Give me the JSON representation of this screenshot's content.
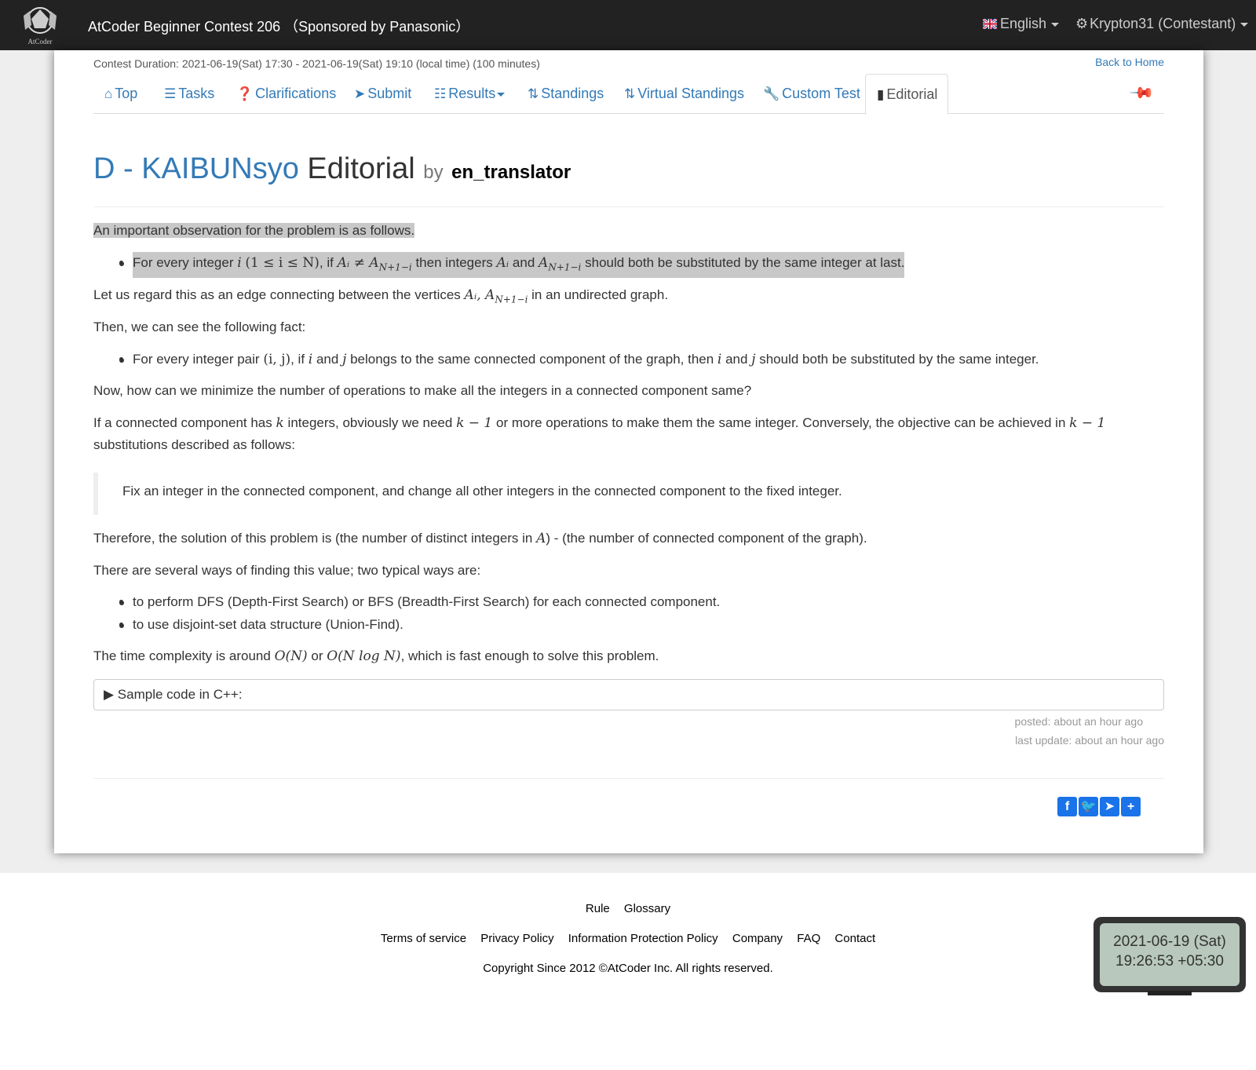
{
  "header": {
    "contest_title": "AtCoder Beginner Contest 206 （Sponsored by Panasonic）",
    "language": "English",
    "user": "Krypton31 (Contestant)"
  },
  "contest": {
    "duration": "Contest Duration: 2021-06-19(Sat) 17:30 - 2021-06-19(Sat) 19:10 (local time) (100 minutes)",
    "back_home": "Back to Home"
  },
  "tabs": [
    {
      "label": "Top",
      "icon": "home-icon"
    },
    {
      "label": "Tasks",
      "icon": "tasks-icon"
    },
    {
      "label": "Clarifications",
      "icon": "question-icon"
    },
    {
      "label": "Submit",
      "icon": "send-icon"
    },
    {
      "label": "Results",
      "icon": "list-icon"
    },
    {
      "label": "Standings",
      "icon": "sort-icon"
    },
    {
      "label": "Virtual Standings",
      "icon": "sort-icon"
    },
    {
      "label": "Custom Test",
      "icon": "wrench-icon"
    },
    {
      "label": "Editorial",
      "icon": "book-icon",
      "active": true
    }
  ],
  "editorial": {
    "task_link": "D - KAIBUNsyo",
    "title_suffix": "Editorial",
    "by": "by",
    "author": "en_translator"
  },
  "content": {
    "p1": "An important observation for the problem is as follows.",
    "b1_a": "For every integer",
    "b1_b": ", if",
    "b1_c": "then integers",
    "b1_d": "and",
    "b1_e": "should both be substituted by the same integer at last.",
    "p2_a": "Let us regard this as an edge connecting between the vertices",
    "p2_b": "in an undirected graph.",
    "p3": "Then, we can see the following fact:",
    "b2_a": "For every integer pair",
    "b2_b": ", if",
    "b2_c": "and",
    "b2_d": "belongs to the same connected component of the graph, then",
    "b2_e": "and",
    "b2_f": "should both be substituted by the same integer.",
    "p4": "Now, how can we minimize the number of operations to make all the integers in a connected component same?",
    "p5_a": "If a connected component has",
    "p5_b": "integers, obviously we need",
    "p5_c": "or more operations to make them the same integer. Conversely, the objective can be achieved in",
    "p5_d": "substitutions described as follows:",
    "quote": "Fix an integer in the connected component, and change all other integers in the connected component to the fixed integer.",
    "p6_a": "Therefore, the solution of this problem is (the number of distinct integers in",
    "p6_b": ") - (the number of connected component of the graph).",
    "p7": "There are several ways of finding this value; two typical ways are:",
    "b3": "to perform DFS (Depth-First Search) or BFS (Breadth-First Search) for each connected component.",
    "b4": "to use disjoint-set data structure (Union-Find).",
    "p8_a": "The time complexity is around",
    "p8_b": "or",
    "p8_c": ", which is fast enough to solve this problem.",
    "sample_code": "▶ Sample code in C++:",
    "posted": "posted: about an hour ago",
    "last_update": "last update: about an hour ago"
  },
  "math": {
    "i": "i",
    "range": "(1 ≤ i ≤ N)",
    "neq": "Aᵢ ≠ A",
    "sub": "N+1−i",
    "Ai": "Aᵢ",
    "A": "A",
    "verts_a": "Aᵢ, A",
    "pair": "(i, j)",
    "j": "j",
    "k": "k",
    "k1": "k − 1",
    "ON": "O(N)",
    "ONlogN": "O(N log N)"
  },
  "footer": {
    "row1": [
      "Rule",
      "Glossary"
    ],
    "row2": [
      "Terms of service",
      "Privacy Policy",
      "Information Protection Policy",
      "Company",
      "FAQ",
      "Contact"
    ],
    "copyright": "Copyright Since 2012 ©AtCoder Inc. All rights reserved."
  },
  "clock": {
    "date": "2021-06-19 (Sat)",
    "time": "19:26:53 +05:30"
  },
  "share_icons": [
    "facebook-icon",
    "twitter-icon",
    "telegram-icon",
    "plus-icon"
  ],
  "colors": {
    "link": "#337ab7",
    "topbar": "#222222",
    "highlight": "#c8c8c8"
  }
}
